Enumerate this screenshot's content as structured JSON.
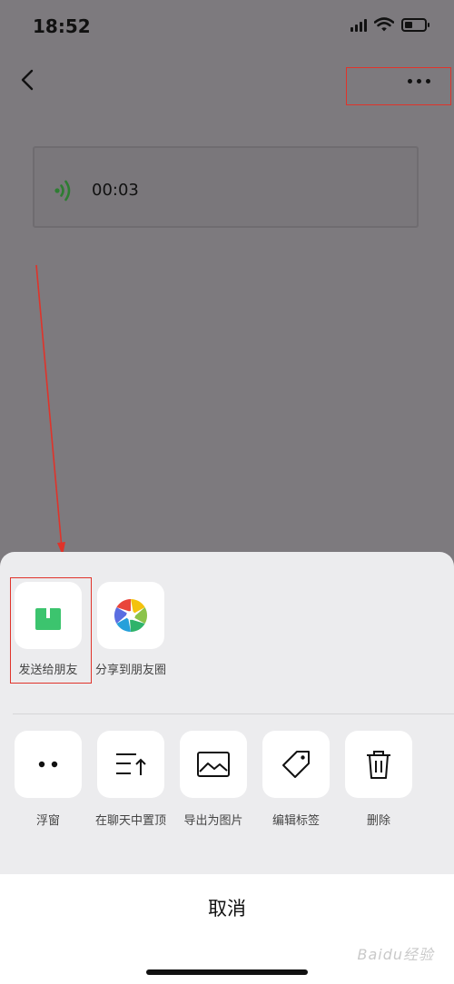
{
  "status_bar": {
    "time": "18:52",
    "icons": [
      "signal-icon",
      "wifi-icon",
      "battery-icon"
    ]
  },
  "nav": {
    "back_icon": "chevron-left-icon",
    "more_icon": "more-dots-icon"
  },
  "voice_message": {
    "icon": "voice-wave-icon",
    "duration": "00:03",
    "accent": "#2e7d32"
  },
  "share_row": [
    {
      "label": "发送给朋友",
      "icon": "share-upload-icon",
      "icon_color": "#3cc46e"
    },
    {
      "label": "分享到朋友圈",
      "icon": "moments-aperture-icon"
    }
  ],
  "action_row": [
    {
      "label": "浮窗",
      "icon": "float-window-icon"
    },
    {
      "label": "在聊天中置顶",
      "icon": "pin-top-icon"
    },
    {
      "label": "导出为图片",
      "icon": "image-icon"
    },
    {
      "label": "编辑标签",
      "icon": "tag-icon"
    },
    {
      "label": "删除",
      "icon": "trash-icon"
    }
  ],
  "cancel_label": "取消",
  "watermark": "Baidu经验",
  "annotation_color": "#e0332a"
}
